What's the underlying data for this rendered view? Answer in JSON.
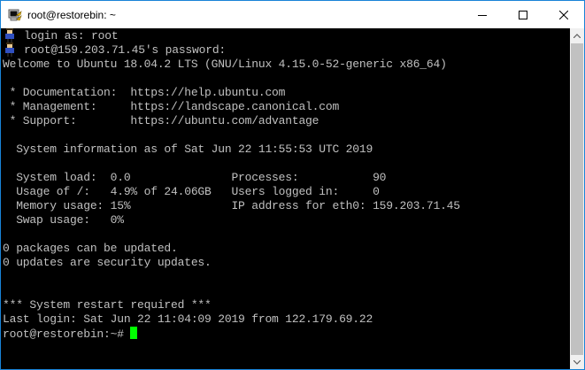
{
  "window": {
    "title": "root@restorebin: ~",
    "icon": "putty-terminal-icon",
    "controls": [
      "minimize-icon",
      "maximize-icon",
      "close-icon"
    ]
  },
  "terminal": {
    "login_prompt": "login as: root",
    "password_prompt": "root@159.203.71.45's password:",
    "welcome": "Welcome to Ubuntu 18.04.2 LTS (GNU/Linux 4.15.0-52-generic x86_64)",
    "links": [
      " * Documentation:  https://help.ubuntu.com",
      " * Management:     https://landscape.canonical.com",
      " * Support:        https://ubuntu.com/advantage"
    ],
    "sysinfo_header": "  System information as of Sat Jun 22 11:55:53 UTC 2019",
    "stats": [
      "  System load:  0.0               Processes:           90",
      "  Usage of /:   4.9% of 24.06GB   Users logged in:     0",
      "  Memory usage: 15%               IP address for eth0: 159.203.71.45",
      "  Swap usage:   0%"
    ],
    "updates": [
      "0 packages can be updated.",
      "0 updates are security updates."
    ],
    "restart_notice": "*** System restart required ***",
    "last_login": "Last login: Sat Jun 22 11:04:09 2019 from 122.179.69.22",
    "prompt": "root@restorebin:~# "
  },
  "colors": {
    "background": "#000000",
    "text": "#c0c0c0",
    "cursor": "#00ff00",
    "titlebar": "#ffffff",
    "border": "#1883d7"
  }
}
